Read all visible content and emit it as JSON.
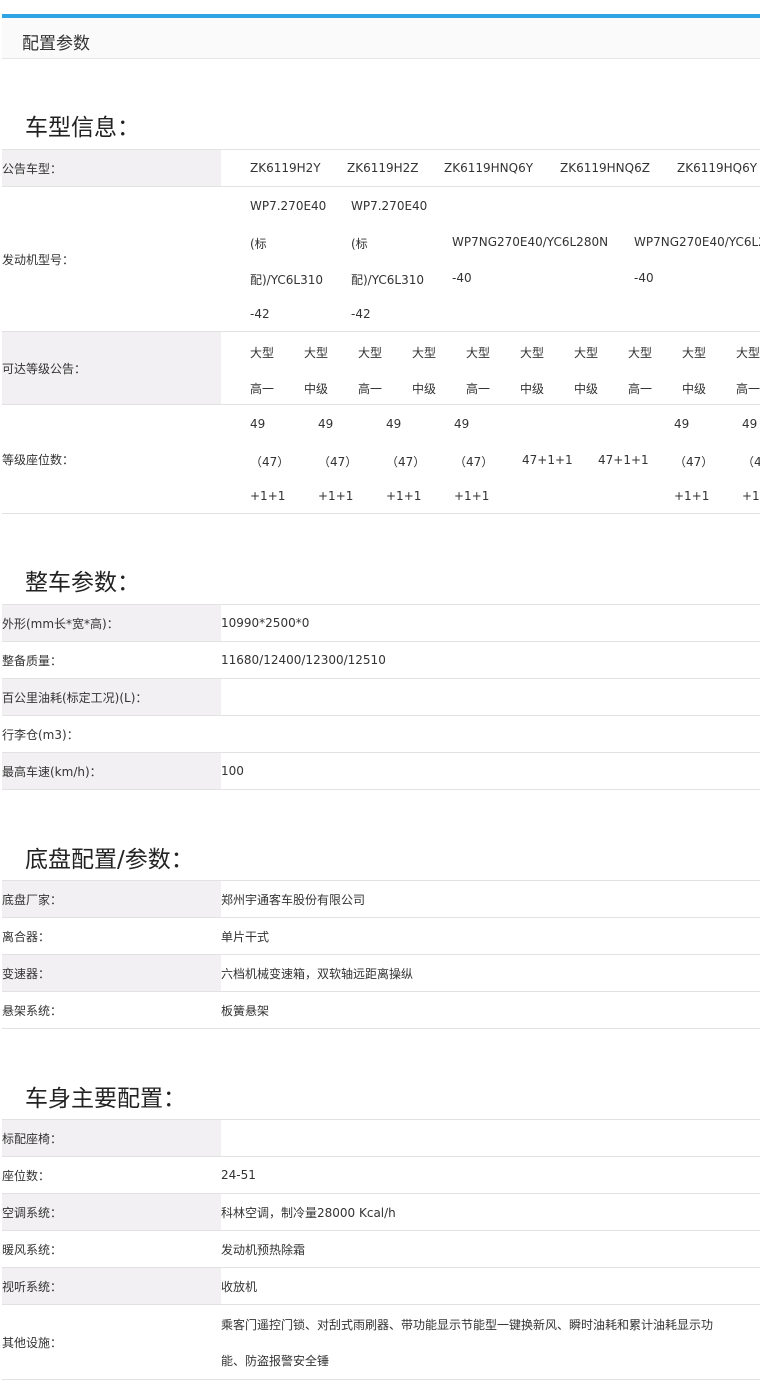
{
  "panel": {
    "title": "配置参数"
  },
  "sections": {
    "vehicle_info": {
      "title": "车型信息：",
      "notice_model": {
        "label": "公告车型：",
        "values": [
          "ZK6119H2Y",
          "ZK6119H2Z",
          "ZK6119HNQ6Y",
          "ZK6119HNQ6Z",
          "ZK6119HQ6Y"
        ]
      },
      "engine_model": {
        "label": "发动机型号：",
        "values": [
          [
            "WP7.270E40",
            "(标",
            "配)/YC6L310",
            "-42"
          ],
          [
            "WP7.270E40",
            "(标",
            "配)/YC6L310",
            "-42"
          ],
          [
            "WP7NG270E40/YC6L280N",
            "-40"
          ],
          [
            "WP7NG270E40/YC6L2",
            "-40"
          ]
        ]
      },
      "grade": {
        "label": "可达等级公告：",
        "values": [
          [
            "大型",
            "高一"
          ],
          [
            "大型",
            "中级"
          ],
          [
            "大型",
            "高一"
          ],
          [
            "大型",
            "中级"
          ],
          [
            "大型",
            "高一"
          ],
          [
            "大型",
            "中级"
          ],
          [
            "大型",
            "中级"
          ],
          [
            "大型",
            "高一"
          ],
          [
            "大型",
            "中级"
          ],
          [
            "大型",
            "高一"
          ]
        ]
      },
      "seats": {
        "label": "等级座位数：",
        "values": [
          [
            "49",
            "（47）",
            "+1+1"
          ],
          [
            "49",
            "（47）",
            "+1+1"
          ],
          [
            "49",
            "（47）",
            "+1+1"
          ],
          [
            "49",
            "（47）",
            "+1+1"
          ],
          [
            "47+1+1"
          ],
          [
            "47+1+1"
          ],
          [
            "49",
            "（47）",
            "+1+1"
          ],
          [
            "49",
            "（4",
            "+1"
          ]
        ]
      }
    },
    "vehicle_params": {
      "title": "整车参数：",
      "rows": [
        {
          "label": "外形(mm长*宽*高)：",
          "value": "10990*2500*0"
        },
        {
          "label": "整备质量：",
          "value": "11680/12400/12300/12510"
        },
        {
          "label": "百公里油耗(标定工况)(L)：",
          "value": ""
        },
        {
          "label": "行李仓(m3)：",
          "value": ""
        },
        {
          "label": "最高车速(km/h)：",
          "value": "100"
        }
      ]
    },
    "chassis": {
      "title": "底盘配置/参数：",
      "rows": [
        {
          "label": "底盘厂家：",
          "value": "郑州宇通客车股份有限公司"
        },
        {
          "label": "离合器：",
          "value": "单片干式"
        },
        {
          "label": "变速器：",
          "value": "六档机械变速箱，双软轴远距离操纵"
        },
        {
          "label": "悬架系统：",
          "value": "板簧悬架"
        }
      ]
    },
    "body": {
      "title": "车身主要配置：",
      "rows": [
        {
          "label": "标配座椅：",
          "value": ""
        },
        {
          "label": "座位数：",
          "value": "24-51"
        },
        {
          "label": "空调系统：",
          "value": "科林空调，制冷量28000 Kcal/h"
        },
        {
          "label": "暖风系统：",
          "value": "发动机预热除霜"
        },
        {
          "label": "视听系统：",
          "value": "收放机"
        },
        {
          "label": "其他设施：",
          "value": "乘客门遥控门锁、对刮式雨刷器、带功能显示节能型一键换新风、瞬时油耗和累计油耗显示功能、防盗报警安全锤"
        }
      ]
    }
  }
}
